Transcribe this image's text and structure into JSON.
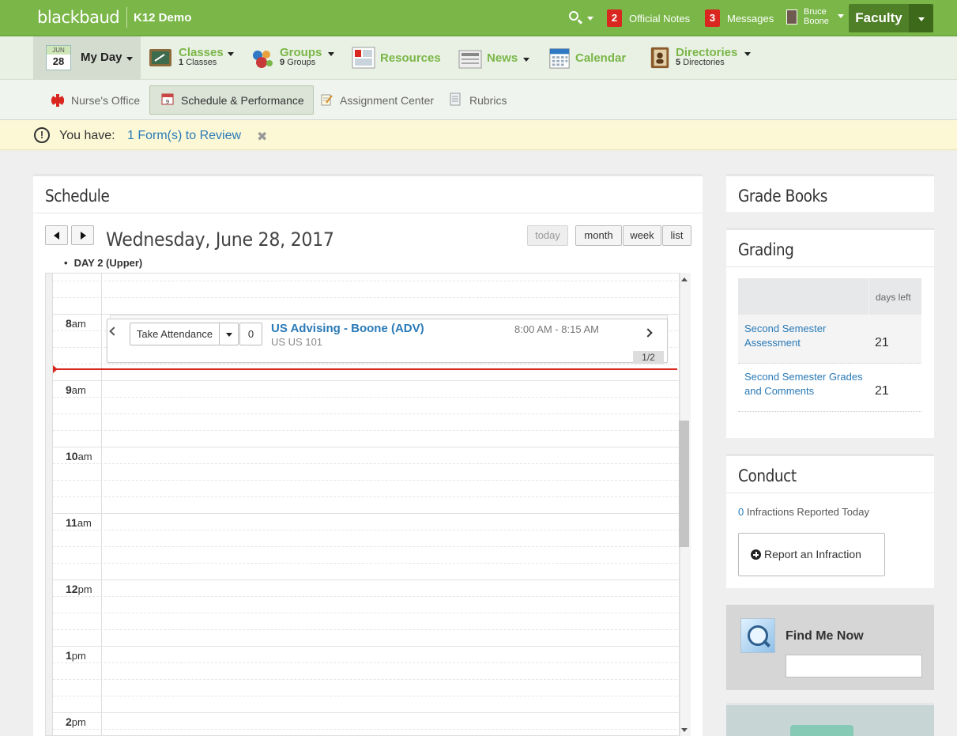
{
  "topbar": {
    "brand": "blackbaud",
    "brand_sub": "K12 Demo",
    "official_notes_count": "2",
    "official_notes_label": "Official Notes",
    "messages_count": "3",
    "messages_label": "Messages",
    "user_first": "Bruce",
    "user_last": "Boone",
    "role": "Faculty",
    "colors": {
      "bar": "#7ab648",
      "badge": "#d9271f",
      "role_button": "#4f7f26"
    }
  },
  "mainnav": {
    "myday": {
      "cal_month": "JUN",
      "cal_day": "28",
      "label": "My Day"
    },
    "classes": {
      "label": "Classes",
      "count": "1",
      "sub": "Classes"
    },
    "groups": {
      "label": "Groups",
      "count": "9",
      "sub": "Groups"
    },
    "resources": {
      "label": "Resources"
    },
    "news": {
      "label": "News"
    },
    "calendar": {
      "label": "Calendar"
    },
    "directories": {
      "label": "Directories",
      "count": "5",
      "sub": "Directories"
    }
  },
  "subnav": {
    "items": [
      {
        "label": "Nurse's Office",
        "icon": "red-cross-icon"
      },
      {
        "label": "Schedule & Performance",
        "icon": "calendar-icon",
        "active": true
      },
      {
        "label": "Assignment Center",
        "icon": "notepad-icon"
      },
      {
        "label": "Rubrics",
        "icon": "document-icon"
      }
    ]
  },
  "alert": {
    "prefix": "You have:",
    "link": "1 Form(s) to Review",
    "close": "✖"
  },
  "schedule": {
    "title": "Schedule",
    "date": "Wednesday, June 28, 2017",
    "views": {
      "today": "today",
      "month": "month",
      "week": "week",
      "list": "list"
    },
    "day_label": "DAY 2 (Upper)",
    "hours": [
      {
        "num": "8",
        "suffix": "am"
      },
      {
        "num": "9",
        "suffix": "am"
      },
      {
        "num": "10",
        "suffix": "am"
      },
      {
        "num": "11",
        "suffix": "am"
      },
      {
        "num": "12",
        "suffix": "pm"
      },
      {
        "num": "1",
        "suffix": "pm"
      },
      {
        "num": "2",
        "suffix": "pm"
      }
    ],
    "event": {
      "attendance_label": "Take Attendance",
      "count": "0",
      "title": "US Advising - Boone (ADV)",
      "subtitle": "US US 101",
      "time": "8:00 AM - 8:15 AM",
      "pager": "1/2"
    }
  },
  "gradebooks": {
    "title": "Grade Books"
  },
  "grading": {
    "title": "Grading",
    "col_days_left": "days left",
    "rows": [
      {
        "name": "Second Semester Assessment",
        "days": "21"
      },
      {
        "name": "Second Semester Grades and Comments",
        "days": "21"
      }
    ]
  },
  "conduct": {
    "title": "Conduct",
    "count": "0",
    "text": " Infractions Reported Today",
    "button": "Report an Infraction"
  },
  "findme": {
    "label": "Find Me Now",
    "value": ""
  }
}
